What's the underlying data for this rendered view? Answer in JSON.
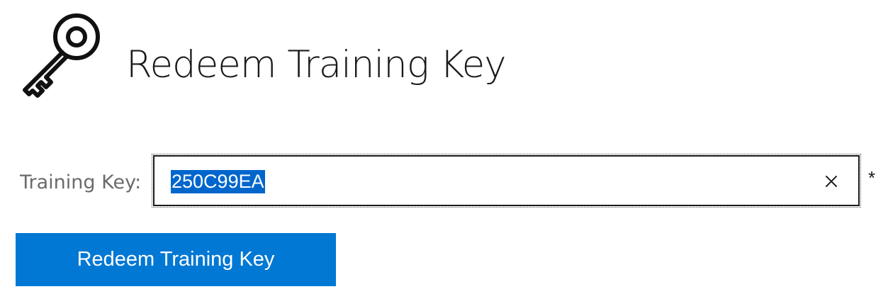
{
  "header": {
    "title": "Redeem Training Key",
    "icon": "key-icon"
  },
  "form": {
    "training_key": {
      "label": "Training Key:",
      "value": "250C99EA",
      "required_marker": "*",
      "clear_icon": "close-icon"
    },
    "submit_label": "Redeem Training Key"
  },
  "colors": {
    "button_bg": "#0078d4",
    "selection_bg": "#0066cc",
    "label_text": "#6b6b6b"
  }
}
